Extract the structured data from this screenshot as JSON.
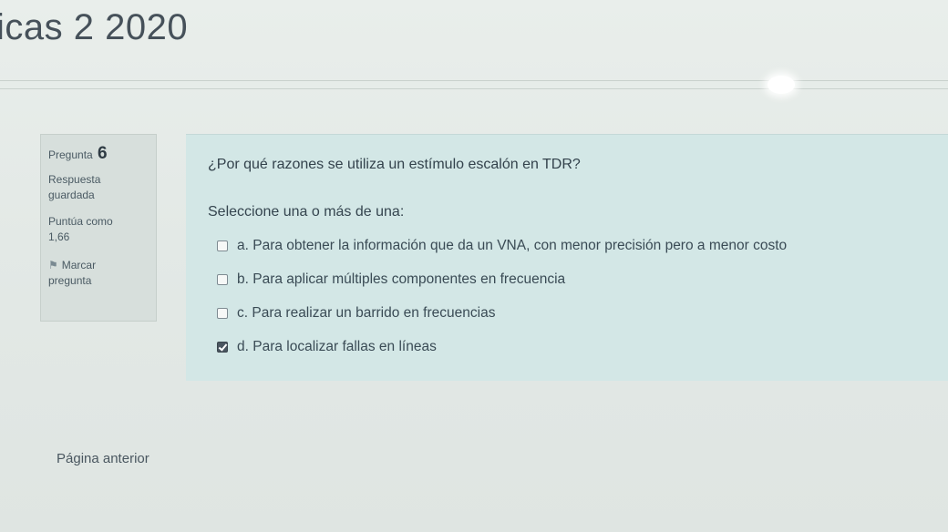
{
  "header": {
    "course_title": "icas 2 2020"
  },
  "question_info": {
    "label": "Pregunta",
    "number": "6",
    "status_line1": "Respuesta",
    "status_line2": "guardada",
    "grade_line1": "Puntúa como",
    "grade_line2": "1,66",
    "flag_line1": "Marcar",
    "flag_line2": "pregunta",
    "flag_icon": "flag-icon"
  },
  "question": {
    "text": "¿Por qué razones se utiliza un estímulo escalón en TDR?",
    "prompt": "Seleccione una o más de una:",
    "answers": [
      {
        "label": "a. Para obtener la información que da un VNA, con menor precisión pero a menor costo",
        "checked": false
      },
      {
        "label": "b. Para aplicar múltiples componentes en frecuencia",
        "checked": false
      },
      {
        "label": "c. Para realizar un barrido en frecuencias",
        "checked": false
      },
      {
        "label": "d. Para localizar fallas en líneas",
        "checked": true
      }
    ]
  },
  "navigation": {
    "previous_page": "Página anterior"
  }
}
